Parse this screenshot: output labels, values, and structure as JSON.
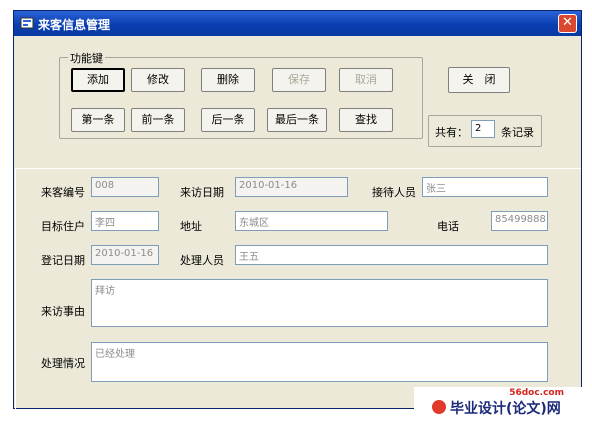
{
  "window": {
    "title": "来客信息管理"
  },
  "group_function": {
    "legend": "功能键",
    "buttons": {
      "add": "添加",
      "edit": "修改",
      "delete": "删除",
      "save": "保存",
      "cancel": "取消",
      "first": "第一条",
      "prev": "前一条",
      "next": "后一条",
      "last": "最后一条",
      "find": "查找"
    }
  },
  "close_button": "关　闭",
  "record_count": {
    "prefix": "共有：",
    "value": "2",
    "suffix": "条记录"
  },
  "form": {
    "visitor_no": {
      "label": "来客编号",
      "value": "008"
    },
    "visit_date": {
      "label": "来访日期",
      "value": "2010-01-16"
    },
    "receptionist": {
      "label": "接待人员",
      "value": "张三"
    },
    "target_resident": {
      "label": "目标住户",
      "value": "李四"
    },
    "address": {
      "label": "地址",
      "value": "东城区"
    },
    "phone": {
      "label": "电话",
      "value": "85499888"
    },
    "register_date": {
      "label": "登记日期",
      "value": "2010-01-16"
    },
    "handler": {
      "label": "处理人员",
      "value": "王五"
    },
    "reason": {
      "label": "来访事由",
      "value": "拜访"
    },
    "result": {
      "label": "处理情况",
      "value": "已经处理"
    }
  },
  "logo": {
    "site": "56doc.com",
    "text": "毕业设计(论文)网"
  },
  "colors": {
    "titlebar": "#0a3fb0",
    "window_bg": "#ece9d8",
    "close_red": "#d9482f"
  }
}
